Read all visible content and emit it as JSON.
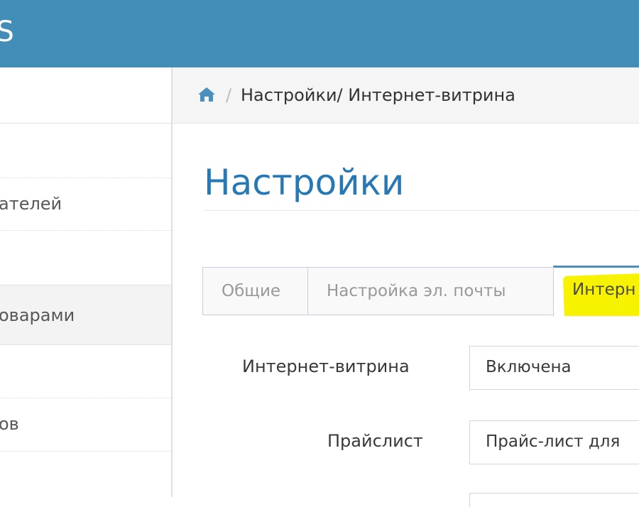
{
  "app": {
    "brand": "OS"
  },
  "sidebar": {
    "items": [
      {
        "label": ""
      },
      {
        "label": "ателей"
      },
      {
        "label": ""
      },
      {
        "label": "оварами"
      },
      {
        "label": ""
      },
      {
        "label": "ов"
      },
      {
        "label": ""
      }
    ]
  },
  "breadcrumb": {
    "separator": "/",
    "text": "Настройки/ Интернет-витрина"
  },
  "page": {
    "title": "Настройки"
  },
  "tabs": [
    {
      "label": "Общие"
    },
    {
      "label": "Настройка эл. почты"
    },
    {
      "label": "Интерн"
    }
  ],
  "form": {
    "fields": [
      {
        "label": "Интернет-витрина",
        "value": "Включена"
      },
      {
        "label": "Прайслист",
        "value": "Прайс-лист для"
      }
    ]
  },
  "colors": {
    "topbar": "#438eb9",
    "title": "#2679b5",
    "highlight": "#f7f200",
    "tab_active_border": "#4c8fbd"
  },
  "icons": {
    "breadcrumb_home": "home-icon"
  }
}
